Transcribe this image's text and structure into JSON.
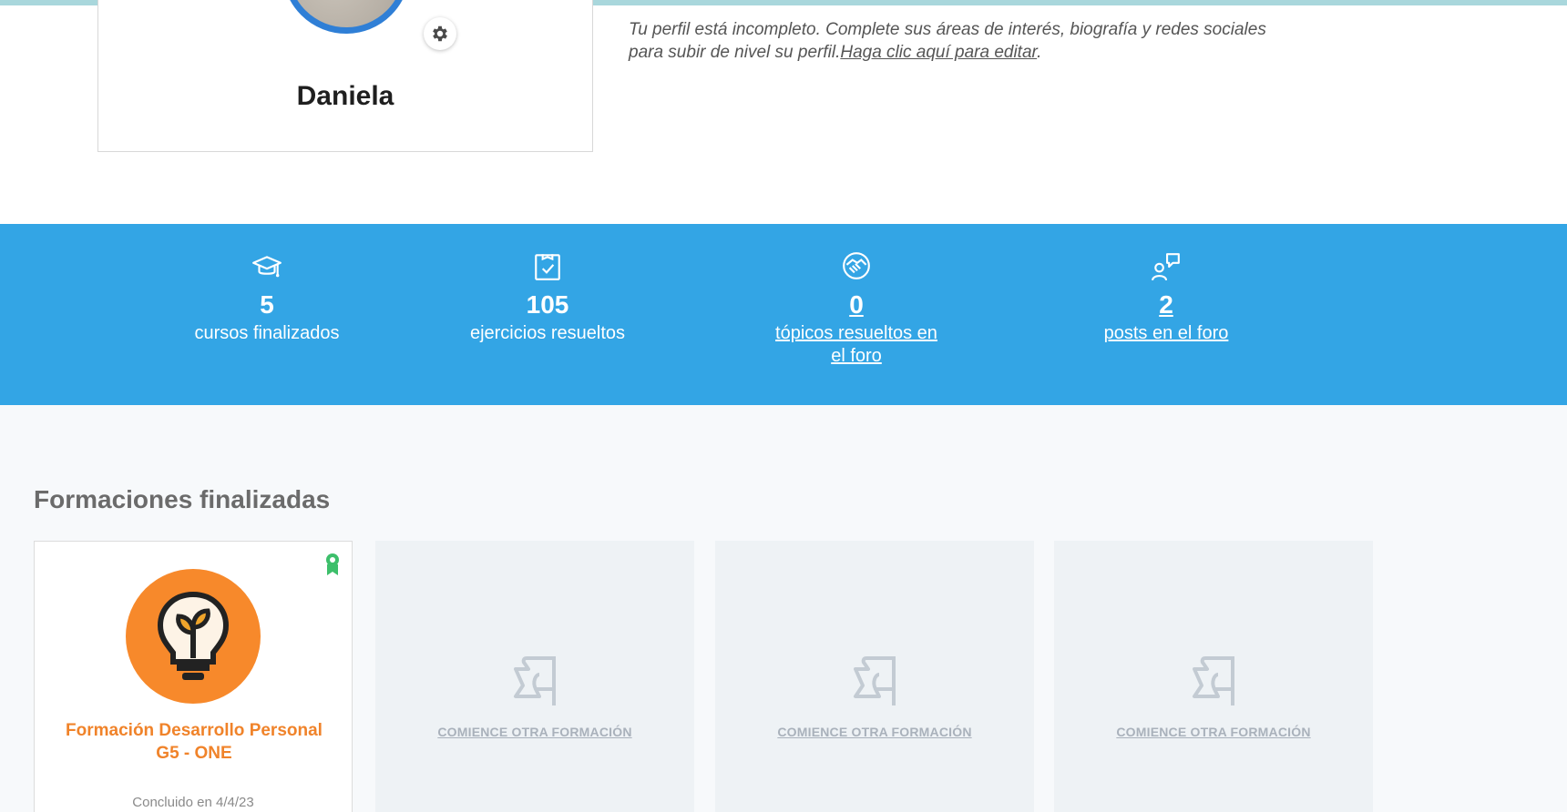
{
  "profile": {
    "name": "Daniela",
    "incomplete_text": "Tu perfil está incompleto. Complete sus áreas de interés, biografía y redes sociales para subir de nivel su perfil.",
    "edit_link": "Haga clic aquí para editar",
    "edit_suffix": "."
  },
  "stats": [
    {
      "icon": "graduation-cap-icon",
      "value": "5",
      "label": "cursos finalizados"
    },
    {
      "icon": "clipboard-check-icon",
      "value": "105",
      "label": "ejercicios resueltos"
    },
    {
      "icon": "handshake-icon",
      "value": "0",
      "label": "tópicos resueltos en el foro"
    },
    {
      "icon": "user-message-icon",
      "value": "2",
      "label": "posts en el foro"
    }
  ],
  "finished": {
    "title": "Formaciones finalizadas",
    "course": {
      "title": "Formación Desarrollo Personal G5 - ONE",
      "date": "Concluido en 4/4/23",
      "badge_icon": "certificate-ribbon-icon",
      "logo_icon": "lightbulb-sprout-icon"
    },
    "placeholders": [
      {
        "cta": "COMIENCE OTRA FORMACIÓN"
      },
      {
        "cta": "COMIENCE OTRA FORMACIÓN"
      },
      {
        "cta": "COMIENCE OTRA FORMACIÓN"
      }
    ]
  },
  "colors": {
    "stats_band": "#33a5e5",
    "avatar_ring": "#2f7fd6",
    "course_orange": "#f7892b",
    "badge_green": "#3dbf6b"
  }
}
